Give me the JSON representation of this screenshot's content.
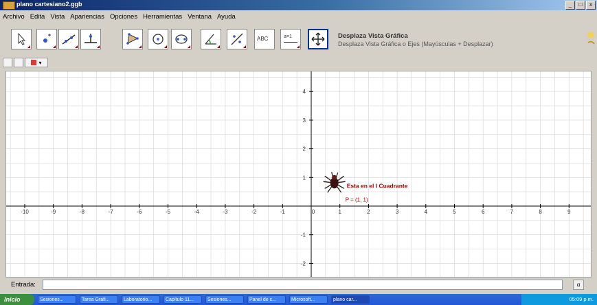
{
  "window": {
    "title": "plano cartesiano2.ggb",
    "btn_min": "_",
    "btn_max": "□",
    "btn_close": "x"
  },
  "menu": [
    {
      "label": "Archivo"
    },
    {
      "label": "Edita"
    },
    {
      "label": "Vista"
    },
    {
      "label": "Apariencias"
    },
    {
      "label": "Opciones"
    },
    {
      "label": "Herramientas"
    },
    {
      "label": "Ventana"
    },
    {
      "label": "Ayuda"
    }
  ],
  "toolbar": {
    "tools": [
      {
        "name": "move-tool",
        "icon": "cursor-icon"
      },
      {
        "name": "point-tool",
        "icon": "point-icon"
      },
      {
        "name": "line-tool",
        "icon": "line-icon"
      },
      {
        "name": "perpendicular-tool",
        "icon": "perpendicular-icon"
      },
      {
        "name": "polygon-tool",
        "icon": "polygon-icon"
      },
      {
        "name": "circle-tool",
        "icon": "circle-icon"
      },
      {
        "name": "conic-tool",
        "icon": "conic-icon"
      },
      {
        "name": "angle-tool",
        "icon": "angle-icon"
      },
      {
        "name": "reflect-tool",
        "icon": "reflect-icon"
      },
      {
        "name": "text-tool",
        "icon": "text-icon",
        "label": "ABC"
      },
      {
        "name": "slider-tool",
        "icon": "slider-icon",
        "label": "a=1"
      },
      {
        "name": "move-graphics-view-tool",
        "icon": "move-view-icon"
      }
    ],
    "selected_name": "Desplaza Vista Gráfica",
    "selected_help": "Desplaza Vista Gráfica o Ejes (Mayúsculas + Desplazar)"
  },
  "graphics": {
    "x_ticks": [
      "-10",
      "-9",
      "-8",
      "-7",
      "-6",
      "-5",
      "-4",
      "-3",
      "-2",
      "-1",
      "0",
      "1",
      "2",
      "3",
      "4",
      "5",
      "6",
      "7",
      "8",
      "9"
    ],
    "y_ticks": [
      "4",
      "3",
      "2",
      "1",
      "-1",
      "-2"
    ],
    "point_caption": "Esta en el I Cuadrante",
    "point_label": "P = (1, 1)",
    "point_value": {
      "x": 1,
      "y": 1
    },
    "caption_color": "#a80000",
    "axis_color": "#000000",
    "grid_color": "#d8d8d8"
  },
  "input": {
    "label": "Entrada:",
    "value": "",
    "button": "α"
  },
  "taskbar": {
    "start": "Inicio",
    "items": [
      {
        "label": "Sesiones..."
      },
      {
        "label": "Tarea Grafi..."
      },
      {
        "label": "Laboratorio..."
      },
      {
        "label": "Capítulo 11..."
      },
      {
        "label": "Sesiones..."
      },
      {
        "label": "Panel de c..."
      },
      {
        "label": "Microsoft..."
      },
      {
        "label": "plano car..."
      }
    ],
    "tray": "05:09 p.m."
  }
}
